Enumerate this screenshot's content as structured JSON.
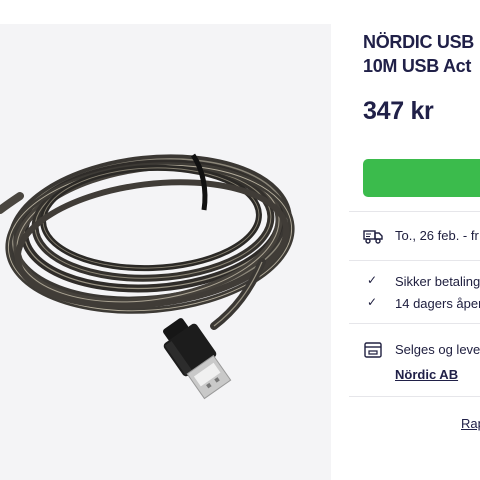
{
  "product": {
    "title_line1": "NÖRDIC USB",
    "title_line2": "10M USB Act",
    "price": "347 kr",
    "image_alt": "USB cable coil",
    "colors": {
      "accent_green": "#3bbb4c",
      "text_dark": "#202048",
      "image_bg": "#f4f4f6"
    }
  },
  "delivery": {
    "icon": "truck-icon",
    "text": "To., 26 feb. - fr"
  },
  "benefits": [
    {
      "icon": "check-icon",
      "text": "Sikker betaling"
    },
    {
      "icon": "check-icon",
      "text": "14 dagers åper"
    }
  ],
  "seller": {
    "icon": "store-icon",
    "label": "Selges og leve",
    "name": "Nördic AB"
  },
  "report_link": "Rap"
}
